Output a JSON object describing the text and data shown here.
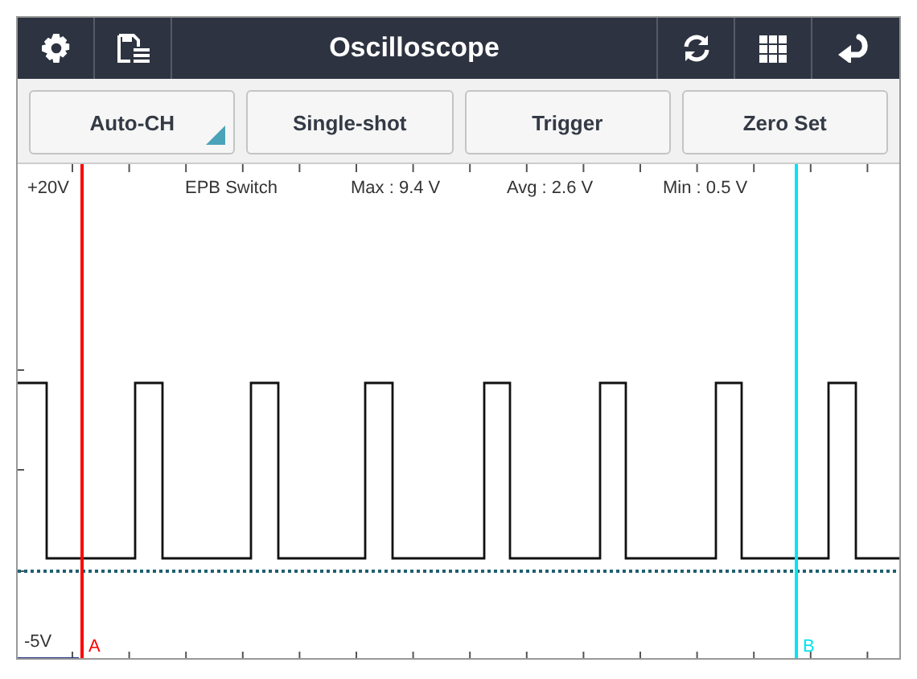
{
  "window": {
    "title": "Oscilloscope"
  },
  "toolbar": {
    "buttons": [
      {
        "label": "Auto-CH",
        "kind": "dropdown"
      },
      {
        "label": "Single-shot",
        "kind": "plain"
      },
      {
        "label": "Trigger",
        "kind": "plain"
      },
      {
        "label": "Zero Set",
        "kind": "plain"
      }
    ]
  },
  "plot": {
    "y_max": "+20V",
    "y_min": "-5V",
    "channel": "EPB Switch",
    "max": "Max : 9.4 V",
    "avg": "Avg : 2.6 V",
    "min": "Min : 0.5 V",
    "cursors": [
      {
        "label": "A",
        "color": "#ff0000"
      },
      {
        "label": "B",
        "color": "#00e5ee"
      }
    ]
  }
}
